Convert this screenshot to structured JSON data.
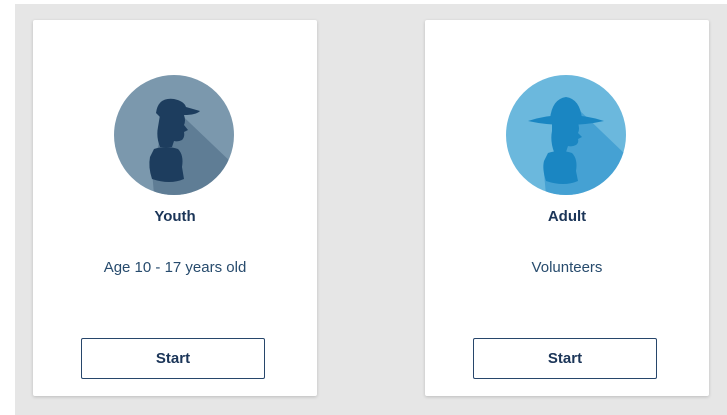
{
  "cards": [
    {
      "title": "Youth",
      "subtitle": "Age 10 - 17 years old",
      "button_label": "Start",
      "icon": "youth-scout-icon",
      "circle_color": "#7b98ad",
      "figure_color": "#1d3d5e"
    },
    {
      "title": "Adult",
      "subtitle": "Volunteers",
      "button_label": "Start",
      "icon": "adult-scout-icon",
      "circle_color": "#6bb8dd",
      "figure_color": "#1a86c2"
    }
  ]
}
